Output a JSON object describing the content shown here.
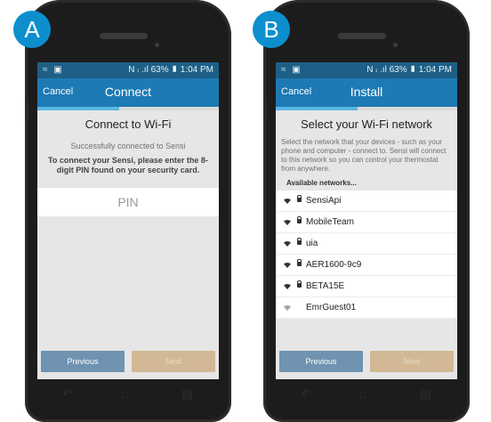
{
  "labels": {
    "a": "A",
    "b": "B"
  },
  "phone_a": {
    "status": {
      "left_icons": "≈ ▣",
      "right": "N ⨾ .ıl 63% ▮ 1:04 PM"
    },
    "nav": {
      "cancel": "Cancel",
      "title": "Connect"
    },
    "progress_fraction": 0.45,
    "heading": "Connect to Wi-Fi",
    "success": "Successfully connected to Sensi",
    "instruction": "To connect your Sensi, please enter the 8-digit PIN found on your security card.",
    "pin_placeholder": "PIN",
    "buttons": {
      "previous": "Previous",
      "next": "Next"
    }
  },
  "phone_b": {
    "status": {
      "left_icons": "≈ ▣",
      "right": "N ⨾ .ıl 63% ▮ 1:04 PM"
    },
    "nav": {
      "cancel": "Cancel",
      "title": "Install"
    },
    "progress_fraction": 0.45,
    "heading": "Select your Wi-Fi network",
    "description": "Select the network that your devices - such as your phone and computer - connect to. Sensi will connect to this network so you can control your thermostat from anywhere.",
    "available_label": "Available networks...",
    "networks": [
      {
        "name": "SensiApi",
        "secured": true
      },
      {
        "name": "MobileTeam",
        "secured": true
      },
      {
        "name": "uia",
        "secured": true
      },
      {
        "name": "AER1600-9c9",
        "secured": true
      },
      {
        "name": "BETA15E",
        "secured": true
      },
      {
        "name": "EmrGuest01",
        "secured": false
      }
    ],
    "buttons": {
      "previous": "Previous",
      "next": "Next"
    }
  },
  "colors": {
    "accent": "#1d7ab4",
    "badge": "#0d8fce",
    "prev_button": "#6f93b0",
    "next_button": "#d2b894"
  }
}
